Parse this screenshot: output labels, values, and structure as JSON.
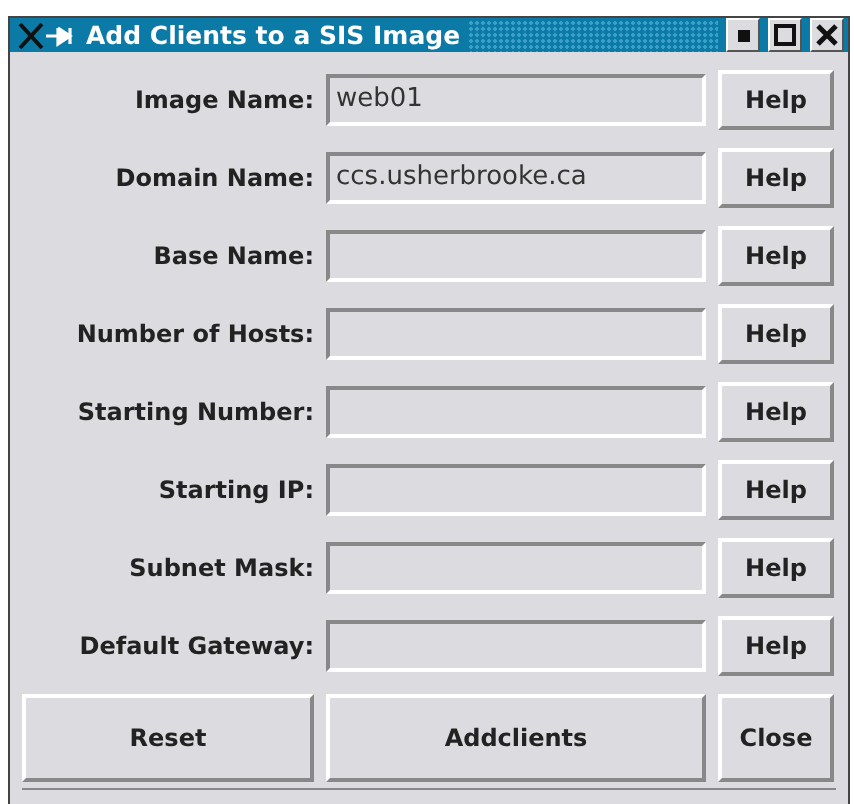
{
  "window": {
    "title": "Add Clients to a SIS Image"
  },
  "fields": [
    {
      "label": "Image Name:",
      "value": "web01",
      "help": "Help"
    },
    {
      "label": "Domain Name:",
      "value": "ccs.usherbrooke.ca",
      "help": "Help"
    },
    {
      "label": "Base Name:",
      "help": "Help"
    },
    {
      "label": "Number of Hosts:",
      "help": "Help"
    },
    {
      "label": "Starting Number:",
      "help": "Help"
    },
    {
      "label": "Starting IP:",
      "help": "Help"
    },
    {
      "label": "Subnet Mask:",
      "help": "Help"
    },
    {
      "label": "Default Gateway:",
      "help": "Help"
    }
  ],
  "buttons": [
    "Reset",
    "Addclients",
    "Close"
  ]
}
